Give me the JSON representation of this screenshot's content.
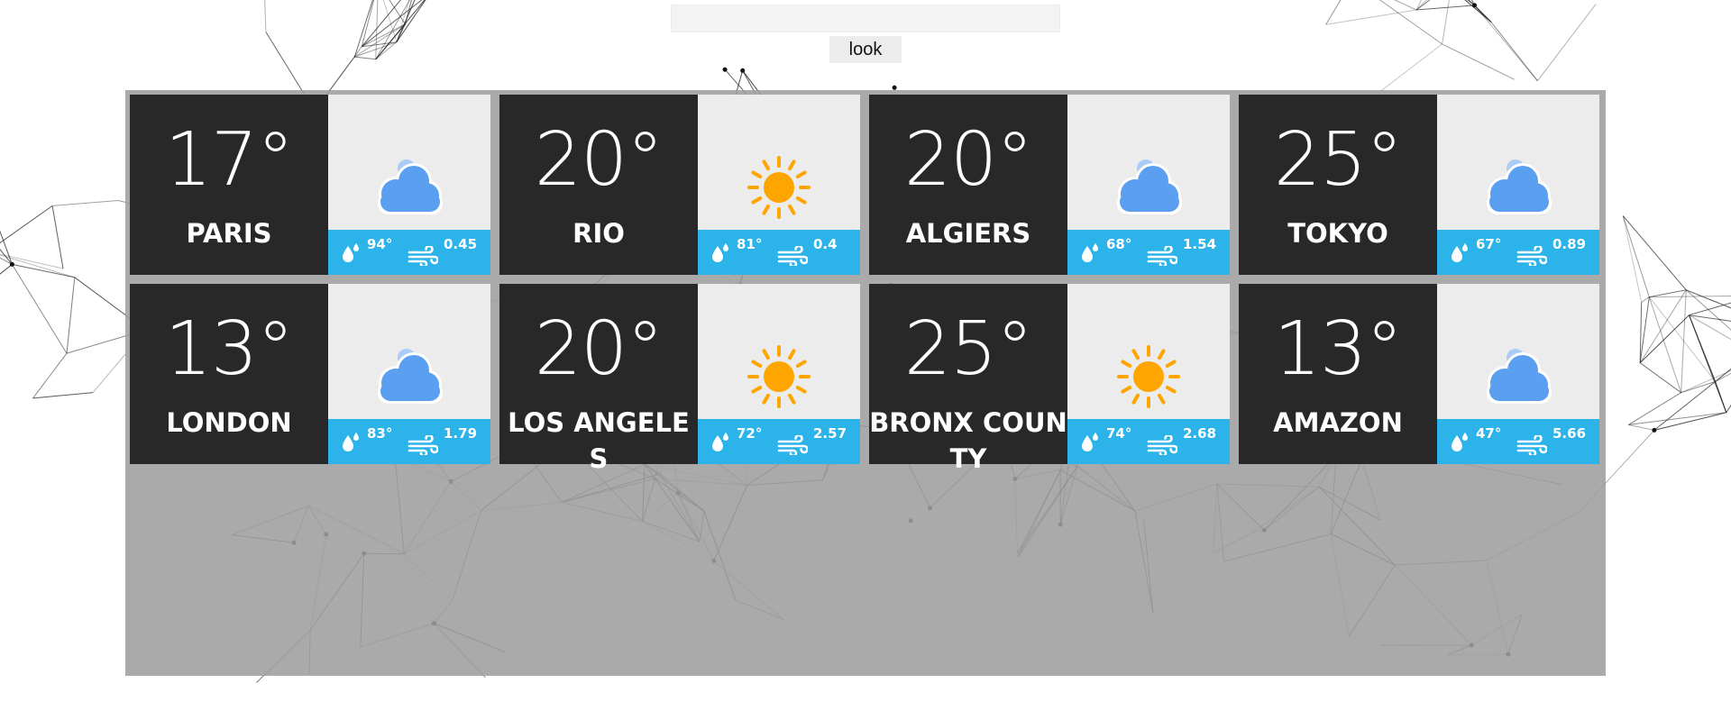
{
  "search": {
    "value": "",
    "placeholder": ""
  },
  "look_button": {
    "label": "look"
  },
  "colors": {
    "card_dark": "#282828",
    "card_light": "#ececec",
    "stats_bar": "#2bb3ea",
    "sun": "#ffa500",
    "cloud": "#5a9ff0"
  },
  "cards": [
    {
      "temp": "17°",
      "city": "PARIS",
      "icon": "cloud-icon",
      "humidity": "94°",
      "wind": "0.45"
    },
    {
      "temp": "20°",
      "city": "RIO",
      "icon": "sun-icon",
      "humidity": "81°",
      "wind": "0.4"
    },
    {
      "temp": "20°",
      "city": "ALGIERS",
      "icon": "cloud-icon",
      "humidity": "68°",
      "wind": "1.54"
    },
    {
      "temp": "25°",
      "city": "TOKYO",
      "icon": "cloud-icon",
      "humidity": "67°",
      "wind": "0.89"
    },
    {
      "temp": "13°",
      "city": "LONDON",
      "icon": "cloud-icon",
      "humidity": "83°",
      "wind": "1.79"
    },
    {
      "temp": "20°",
      "city": "LOS ANGELES",
      "icon": "sun-icon",
      "humidity": "72°",
      "wind": "2.57"
    },
    {
      "temp": "25°",
      "city": "BRONX COUNTY",
      "icon": "sun-icon",
      "humidity": "74°",
      "wind": "2.68"
    },
    {
      "temp": "13°",
      "city": "AMAZON",
      "icon": "cloud-icon",
      "humidity": "47°",
      "wind": "5.66"
    }
  ]
}
